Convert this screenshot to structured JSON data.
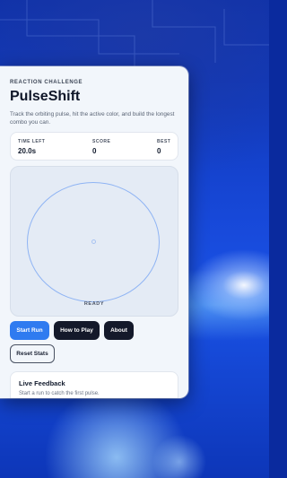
{
  "app": {
    "eyebrow": "REACTION CHALLENGE",
    "title": "PulseShift",
    "subtitle": "Track the orbiting pulse, hit the active color, and build the longest combo you can."
  },
  "stats": [
    {
      "label": "TIME LEFT",
      "value": "20.0s"
    },
    {
      "label": "SCORE",
      "value": "0"
    },
    {
      "label": "BEST",
      "value": "0"
    }
  ],
  "arena": {
    "status": "READY"
  },
  "buttons": {
    "start": "Start Run",
    "how_to_play": "How to Play",
    "about": "About",
    "reset": "Reset Stats"
  },
  "feedback": {
    "title": "Live Feedback",
    "text": "Start a run to catch the first pulse."
  },
  "colors": {
    "accent": "#2f7bf0",
    "dark_button": "#14192a",
    "ring": "#8fb4f4",
    "card_bg": "#f2f6fb"
  }
}
